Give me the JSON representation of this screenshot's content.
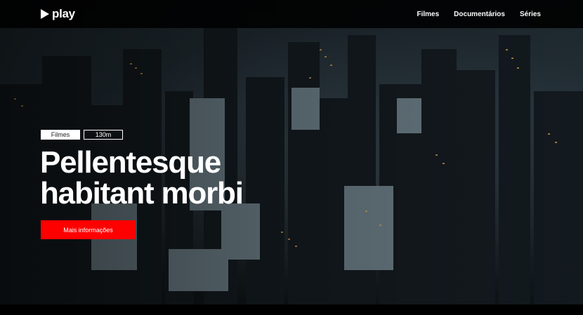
{
  "brand": {
    "name": "play",
    "icon": "play-triangle-icon"
  },
  "nav": {
    "items": [
      {
        "label": "Filmes"
      },
      {
        "label": "Documentários"
      },
      {
        "label": "Séries"
      }
    ]
  },
  "hero": {
    "tags": {
      "category": "Filmes",
      "duration": "130m"
    },
    "title_line1": "Pellentesque",
    "title_line2": "habitant morbi",
    "cta_label": "Mais informações",
    "background": "city-night-aerial-image"
  },
  "colors": {
    "accent": "#ff0000",
    "topbar": "#000000",
    "text": "#ffffff"
  }
}
